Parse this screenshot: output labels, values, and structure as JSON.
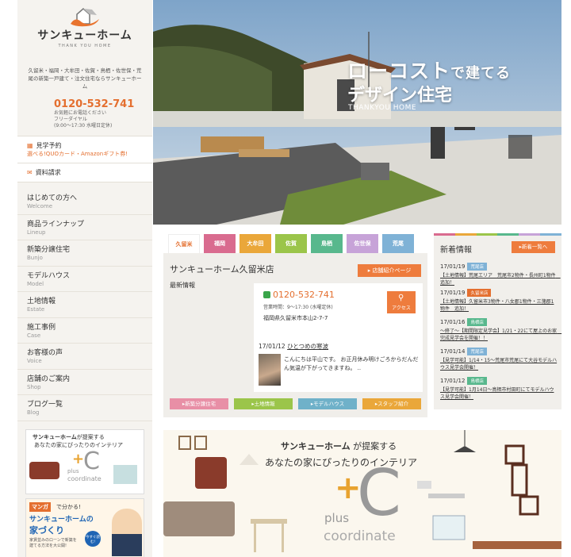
{
  "logo": {
    "name": "サンキューホーム",
    "sub": "THANK YOU HOME"
  },
  "areas": "久留米・福岡・大牟田・佐賀・鳥栖・佐世保・荒尾の新築一戸建て・注文住宅ならサンキューホーム",
  "phone": {
    "number": "0120-532-741",
    "note1": "お気軽にお電話ください",
    "note2": "フリーダイヤル",
    "note3": "(9:00〜17:30 水曜日定休)"
  },
  "side_buttons": [
    {
      "title": "見学予約",
      "sub": "選べる!QUOカード・Amazonギフト券!"
    },
    {
      "title": "資料請求",
      "sub": ""
    }
  ],
  "menu": [
    {
      "jp": "はじめての方へ",
      "en": "Welcome"
    },
    {
      "jp": "商品ラインナップ",
      "en": "Lineup"
    },
    {
      "jp": "新築分譲住宅",
      "en": "Bunjo"
    },
    {
      "jp": "モデルハウス",
      "en": "Model"
    },
    {
      "jp": "土地情報",
      "en": "Estate"
    },
    {
      "jp": "施工事例",
      "en": "Case"
    },
    {
      "jp": "お客様の声",
      "en": "Voice"
    },
    {
      "jp": "店舗のご案内",
      "en": "Shop"
    },
    {
      "jp": "ブログ一覧",
      "en": "Blog"
    }
  ],
  "banner1": {
    "brand": "サンキューホーム",
    "line1": "が提案する",
    "line2": "あなたの家にぴったりのインテリア",
    "plus": "plus",
    "coord": "coordinate"
  },
  "banner2": {
    "manga": "マンガ",
    "line1": "で分かる!",
    "line2": "サンキューホームの",
    "line3": "家づくり",
    "line4": "家賃並みのローンで新築を",
    "line5": "建てる方法を大公開!",
    "badge": "今すぐ読む!"
  },
  "hero": {
    "line1a": "ローコスト",
    "line1b": "で建てる",
    "line2": "デザイン住宅",
    "line3": "THANKYOU HOME"
  },
  "tabs": [
    {
      "label": "久留米",
      "color": "#ffffff",
      "text": "#e46f2f"
    },
    {
      "label": "福岡",
      "color": "#d96b8f",
      "text": "#ffffff"
    },
    {
      "label": "大牟田",
      "color": "#eaa73a",
      "text": "#ffffff"
    },
    {
      "label": "佐賀",
      "color": "#9bc54a",
      "text": "#ffffff"
    },
    {
      "label": "鳥栖",
      "color": "#58b88d",
      "text": "#ffffff"
    },
    {
      "label": "佐世保",
      "color": "#c7a3d8",
      "text": "#ffffff"
    },
    {
      "label": "荒尾",
      "color": "#7fb2d6",
      "text": "#ffffff"
    }
  ],
  "store": {
    "title": "サンキューホーム久留米店",
    "button": "店舗紹介ページ",
    "news_label": "最新情報",
    "phone": "0120-532-741",
    "hours": "営業時間：9〜17:30 (水曜定休)",
    "address": "福岡県久留米市本山2-7-7",
    "access": "アクセス",
    "blog_date": "17/01/12",
    "blog_title": "ひとつめの寒波",
    "blog_body": "こんにちは平山です。 お正月休み明けごろからだんだん気温が下がってきますね。 ..",
    "categories": [
      {
        "label": "新築分譲住宅",
        "color": "#e88fa6"
      },
      {
        "label": "土地情報",
        "color": "#9bc54a"
      },
      {
        "label": "モデルハウス",
        "color": "#6fb1c9"
      },
      {
        "label": "スタッフ紹介",
        "color": "#eaa73a"
      }
    ]
  },
  "news": {
    "title": "新着情報",
    "more": "新着一覧へ",
    "items": [
      {
        "date": "17/01/19",
        "badge": "荒尾店",
        "badge_color": "#7fb2d6",
        "text": "【土地情報】荒尾エリア　荒尾市2物件・長州町1物件　追加！"
      },
      {
        "date": "17/01/19",
        "badge": "久留米店",
        "badge_color": "#e46f2f",
        "text": "【土地情報】久留米市3物件・八女郡1物件・三潴郡1物件　追加！"
      },
      {
        "date": "17/01/16",
        "badge": "鳥栖店",
        "badge_color": "#58b88d",
        "text": "〜終了〜【期間限定見学会】1/21・22にて屋上のお家　完成見学会を開催！！"
      },
      {
        "date": "17/01/14",
        "badge": "荒尾店",
        "badge_color": "#7fb2d6",
        "text": "【見学可能】1/14・15〜荒尾市荒尾にて大谷モデルハウス見学会開催！"
      },
      {
        "date": "17/01/12",
        "badge": "鳥栖店",
        "badge_color": "#58b88d",
        "text": "【見学可能】1月14日〜鳥栖市村田町にてモデルハウス見学会開催！"
      }
    ]
  },
  "bottom_banner": {
    "brand": "サンキューホーム",
    "line1": "が提案する",
    "line2": "あなたの家にぴったりのインテリア",
    "plus": "plus",
    "coord": "coordinate"
  },
  "colors": {
    "accent": "#e46f2f",
    "sidebar_bg": "#f5f3ef"
  }
}
